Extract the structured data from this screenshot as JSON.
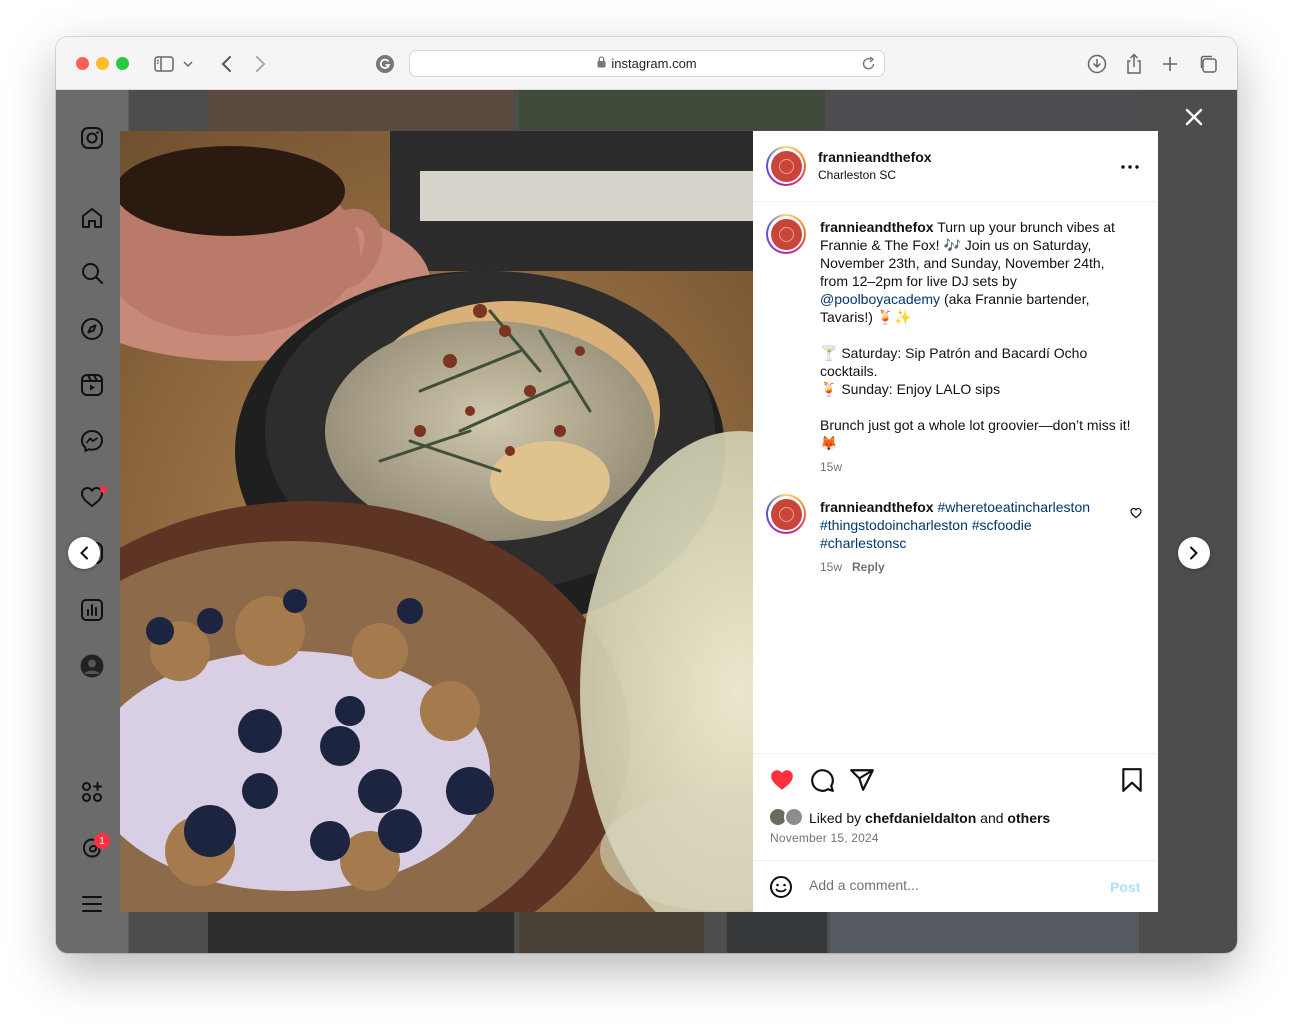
{
  "browser": {
    "url": "instagram.com"
  },
  "post": {
    "username": "frannieandthefox",
    "location": "Charleston SC",
    "caption": {
      "username": "frannieandthefox",
      "line1_text": " Turn up your brunch vibes at Frannie & The Fox! 🎶 Join us on Saturday, November 23th, and Sunday, November 24th, from 12–2pm for live DJ sets by ",
      "mention": "@poolboyacademy",
      "line1_after": " (aka Frannie bartender, Tavaris!) 🍹✨",
      "saturday": "🍸 Saturday: Sip Patrón and Bacardí Ocho cocktails.",
      "sunday": "🍹 Sunday: Enjoy LALO sips",
      "closing": "Brunch just got a whole lot groovier—don’t miss it! 🦊",
      "time": "15w"
    },
    "comment": {
      "username": "frannieandthefox",
      "tags": "#wheretoeatincharleston #thingstodoincharleston #scfoodie #charlestonsc",
      "time": "15w",
      "reply_label": "Reply"
    },
    "likes": {
      "prefix": "Liked by ",
      "user": "chefdanieldalton",
      "middle": " and ",
      "others": "others"
    },
    "date": "November 15, 2024",
    "comment_placeholder": "Add a comment...",
    "post_label": "Post"
  },
  "notifications": {
    "threads_count": "1"
  },
  "colors": {
    "like_red": "#ff3040",
    "link_blue": "#00376b",
    "post_disabled": "#b2dffc"
  }
}
